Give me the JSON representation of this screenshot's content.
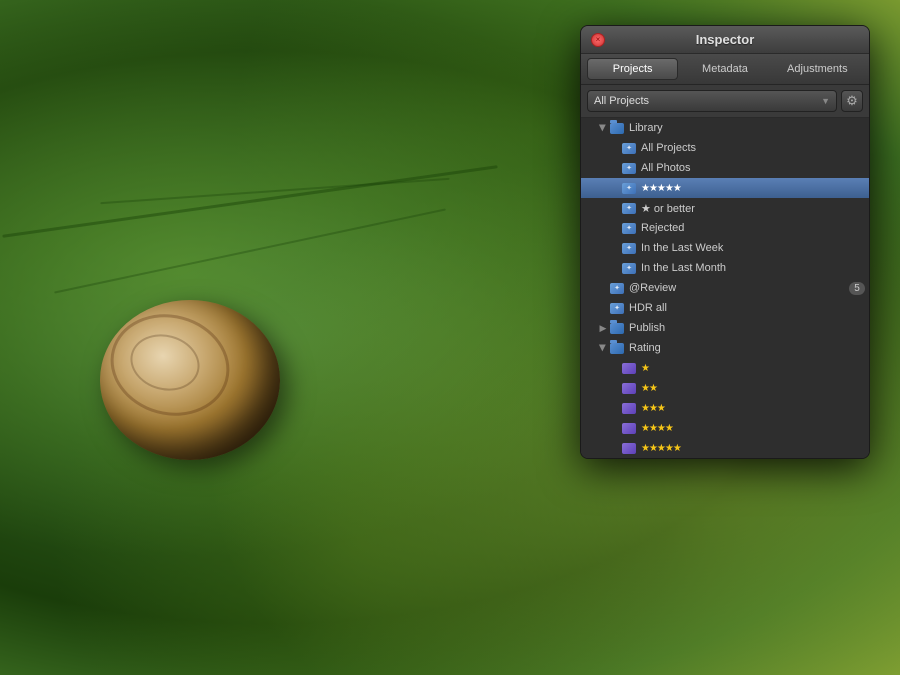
{
  "background": {
    "description": "Green leaf with snail macro photography"
  },
  "inspector": {
    "title": "Inspector",
    "close_label": "×",
    "tabs": [
      {
        "id": "projects",
        "label": "Projects",
        "active": true
      },
      {
        "id": "metadata",
        "label": "Metadata",
        "active": false
      },
      {
        "id": "adjustments",
        "label": "Adjustments",
        "active": false
      }
    ],
    "toolbar": {
      "project_selector_label": "All Projects",
      "gear_icon": "⚙"
    },
    "tree": {
      "items": [
        {
          "id": "library",
          "label": "Library",
          "level": 1,
          "type": "library",
          "expanded": true,
          "has_arrow": true,
          "arrow_open": true
        },
        {
          "id": "all-projects",
          "label": "All Projects",
          "level": 2,
          "type": "smart"
        },
        {
          "id": "all-photos",
          "label": "All Photos",
          "level": 2,
          "type": "smart"
        },
        {
          "id": "five-stars",
          "label": "★★★★★",
          "level": 2,
          "type": "smart",
          "selected": true,
          "is_stars": true,
          "stars": "★★★★★"
        },
        {
          "id": "star-or-better",
          "label": "★ or better",
          "level": 2,
          "type": "smart",
          "is_stars_text": true
        },
        {
          "id": "rejected",
          "label": "Rejected",
          "level": 2,
          "type": "smart"
        },
        {
          "id": "last-week",
          "label": "In the Last Week",
          "level": 2,
          "type": "smart"
        },
        {
          "id": "last-month",
          "label": "In the Last Month",
          "level": 2,
          "type": "smart"
        },
        {
          "id": "review",
          "label": "@Review",
          "level": 1,
          "type": "smart",
          "badge": "5"
        },
        {
          "id": "hdr-all",
          "label": "HDR all",
          "level": 1,
          "type": "smart"
        },
        {
          "id": "publish",
          "label": "Publish",
          "level": 1,
          "type": "library",
          "expanded": false,
          "has_arrow": true,
          "arrow_open": false
        },
        {
          "id": "rating",
          "label": "Rating",
          "level": 1,
          "type": "library",
          "expanded": true,
          "has_arrow": true,
          "arrow_open": true
        },
        {
          "id": "rating-1",
          "label": "★",
          "level": 2,
          "type": "rating",
          "stars": "★",
          "stars_empty": ""
        },
        {
          "id": "rating-2",
          "label": "★★",
          "level": 2,
          "type": "rating",
          "stars": "★★",
          "stars_empty": ""
        },
        {
          "id": "rating-3",
          "label": "★★★",
          "level": 2,
          "type": "rating",
          "stars": "★★★",
          "stars_empty": ""
        },
        {
          "id": "rating-4",
          "label": "★★★★",
          "level": 2,
          "type": "rating",
          "stars": "★★★★",
          "stars_empty": ""
        },
        {
          "id": "rating-5",
          "label": "★★★★★",
          "level": 2,
          "type": "rating",
          "stars": "★★★★★",
          "stars_empty": ""
        }
      ]
    }
  }
}
